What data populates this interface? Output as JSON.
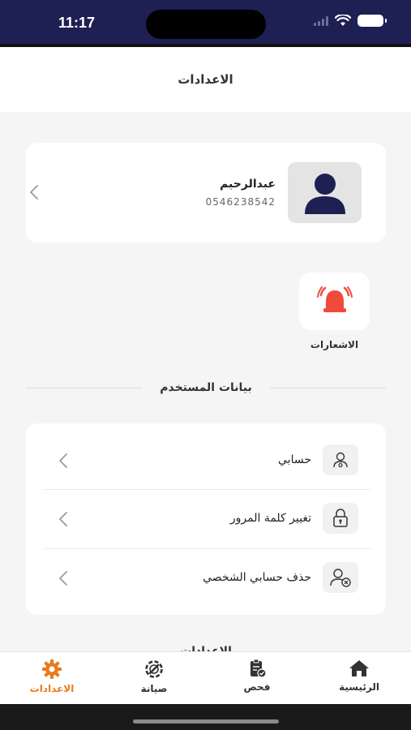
{
  "status": {
    "time": "11:17"
  },
  "header": {
    "title": "الاعدادات"
  },
  "profile": {
    "name": "عبدالرحيم",
    "phone": "0546238542"
  },
  "notifications": {
    "label": "الاشعارات",
    "icon": "bell-alert-icon",
    "color": "#f04a3c"
  },
  "sections": {
    "user_data": "بيانات المستخدم",
    "settings": "الاعدادات"
  },
  "user_items": [
    {
      "label": "حسابي",
      "icon": "user-gear-icon"
    },
    {
      "label": "تغيير كلمة المرور",
      "icon": "lock-icon"
    },
    {
      "label": "حذف حسابي الشخصي",
      "icon": "user-remove-icon"
    }
  ],
  "tabs": [
    {
      "label": "الرئيسية",
      "icon": "home-icon"
    },
    {
      "label": "فحص",
      "icon": "clipboard-check-icon"
    },
    {
      "label": "صيانة",
      "icon": "maintenance-icon"
    },
    {
      "label": "الاعدادات",
      "icon": "gear-icon"
    }
  ],
  "colors": {
    "status_bar": "#1e1f52",
    "accent": "#e87b1e",
    "avatar": "#1e1f52"
  }
}
